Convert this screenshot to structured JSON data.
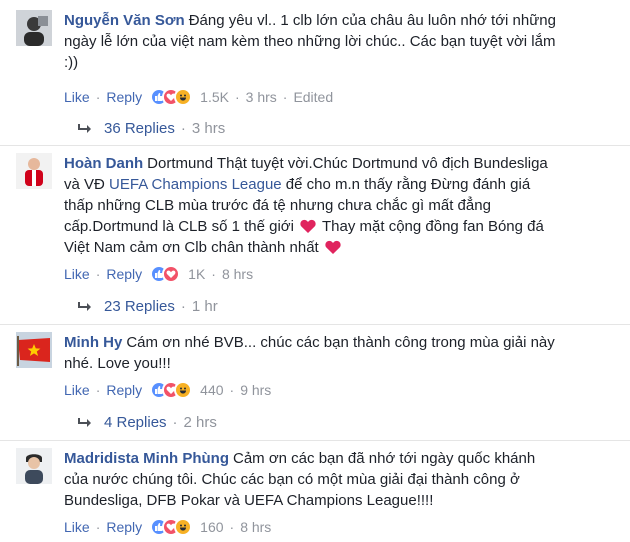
{
  "comments": [
    {
      "author": "Nguyễn Văn Sơn",
      "text_lines": [
        "Đáng yêu vl.. 1 clb lớn của châu âu luôn nhớ tới những",
        "ngày lễ lớn của việt nam kèm theo những lời chúc.. Các bạn tuyệt vời lắm",
        ":))"
      ],
      "like": "Like",
      "reply": "Reply",
      "reaction_count": "1.5K",
      "time": "3 hrs",
      "edited": "Edited",
      "replies_label": "36 Replies",
      "replies_time": "3 hrs",
      "reactions": [
        "like-icon",
        "love-icon",
        "haha-icon"
      ]
    },
    {
      "author": "Hoàn Danh",
      "text_l1": "Dortmund Thật tuyệt vời.Chúc Dortmund vô địch Bundesliga",
      "text_l2a": "và VĐ ",
      "text_l2link": "UEFA Champions League",
      "text_l2b": " để cho m.n thấy rằng Đừng đánh giá",
      "text_l3": "thấp những CLB mùa trước đá tệ nhưng chưa chắc gì mất đẳng",
      "text_l4": "cấp.Dortmund là CLB số 1 thế giới",
      "text_l4b": " Thay mặt cộng đồng fan Bóng đá",
      "text_l5": "Việt Nam cảm ơn Clb chân thành nhất",
      "like": "Like",
      "reply": "Reply",
      "reaction_count": "1K",
      "time": "8 hrs",
      "replies_label": "23 Replies",
      "replies_time": "1 hr",
      "reactions": [
        "like-icon",
        "love-icon"
      ]
    },
    {
      "author": "Minh Hy",
      "text_lines": [
        "Cám ơn nhé BVB... chúc các bạn thành công trong mùa giải này",
        "nhé. Love you!!!"
      ],
      "like": "Like",
      "reply": "Reply",
      "reaction_count": "440",
      "time": "9 hrs",
      "replies_label": "4 Replies",
      "replies_time": "2 hrs",
      "reactions": [
        "like-icon",
        "love-icon",
        "haha-icon"
      ]
    },
    {
      "author": "Madridista Minh Phùng",
      "text_lines": [
        "Cảm ơn các bạn đã nhớ tới ngày quốc khánh",
        "của nước chúng tôi. Chúc các bạn có một mùa giải đại thành công ở",
        "Bundesliga, DFB Pokar và UEFA Champions League!!!!"
      ],
      "like": "Like",
      "reply": "Reply",
      "reaction_count": "160",
      "time": "8 hrs",
      "reactions": [
        "like-icon",
        "love-icon",
        "haha-icon"
      ]
    }
  ],
  "colors": {
    "link": "#365899",
    "action": "#4267b2",
    "meta": "#90949c",
    "text": "#1d2129",
    "like": "#5890ff",
    "love": "#f25268",
    "haha": "#f7b125"
  }
}
